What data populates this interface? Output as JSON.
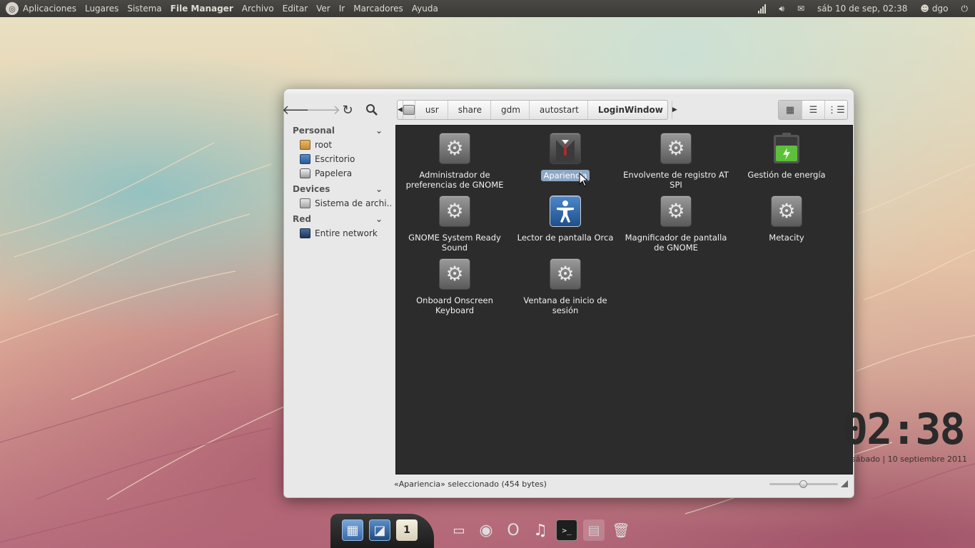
{
  "top_panel": {
    "menus": [
      "Aplicaciones",
      "Lugares",
      "Sistema",
      "File Manager",
      "Archivo",
      "Editar",
      "Ver",
      "Ir",
      "Marcadores",
      "Ayuda"
    ],
    "datetime": "sáb 10 de sep, 02:38",
    "user": "dgo",
    "icons": [
      "ubuntu-logo-icon",
      "signal-icon",
      "volume-icon",
      "mail-icon",
      "user-icon",
      "power-icon"
    ]
  },
  "window": {
    "toolbar": {
      "back": "back-arrow-icon",
      "forward": "forward-arrow-icon",
      "reload": "reload-icon",
      "search": "search-icon"
    },
    "path": [
      "usr",
      "share",
      "gdm",
      "autostart",
      "LoginWindow"
    ],
    "views": [
      "icon-view-icon",
      "list-view-icon",
      "compact-view-icon"
    ],
    "sidebar": {
      "sections": [
        {
          "title": "Personal",
          "items": [
            {
              "label": "root",
              "icon": "home-folder-icon"
            },
            {
              "label": "Escritorio",
              "icon": "desktop-icon"
            },
            {
              "label": "Papelera",
              "icon": "trash-icon"
            }
          ]
        },
        {
          "title": "Devices",
          "items": [
            {
              "label": "Sistema de archi…",
              "icon": "filesystem-icon"
            }
          ]
        },
        {
          "title": "Red",
          "items": [
            {
              "label": "Entire network",
              "icon": "network-icon"
            }
          ]
        }
      ]
    },
    "files": [
      {
        "label": "Administrador de preferencias de GNOME",
        "icon": "gear-icon"
      },
      {
        "label": "Apariencia",
        "icon": "suit-icon",
        "selected": true
      },
      {
        "label": "Envolvente de registro AT SPI",
        "icon": "gear-icon"
      },
      {
        "label": "Gestión de energía",
        "icon": "battery-icon"
      },
      {
        "label": "GNOME System Ready Sound",
        "icon": "gear-icon"
      },
      {
        "label": "Lector de pantalla Orca",
        "icon": "accessibility-icon"
      },
      {
        "label": "Magnificador de pantalla de GNOME",
        "icon": "gear-icon"
      },
      {
        "label": "Metacity",
        "icon": "gear-icon"
      },
      {
        "label": "Onboard Onscreen Keyboard",
        "icon": "gear-icon"
      },
      {
        "label": "Ventana de inicio de sesión",
        "icon": "gear-icon"
      }
    ],
    "status": "«Apariencia» seleccionado (454 bytes)"
  },
  "desktop_clock": {
    "time": "02:38",
    "date": "sábado | 10 septiembre 2011"
  },
  "dock": {
    "items": [
      "workspaces-icon",
      "desktop-icon",
      "calendar-icon",
      "screen-icon",
      "chrome-icon",
      "opera-icon",
      "music-icon",
      "terminal-icon",
      "files-icon",
      "trash-icon"
    ],
    "calendar_day": "1"
  },
  "colors": {
    "panel": "#3f3e3a",
    "content_bg": "#2c2c2c",
    "selection": "#8da7c4"
  }
}
